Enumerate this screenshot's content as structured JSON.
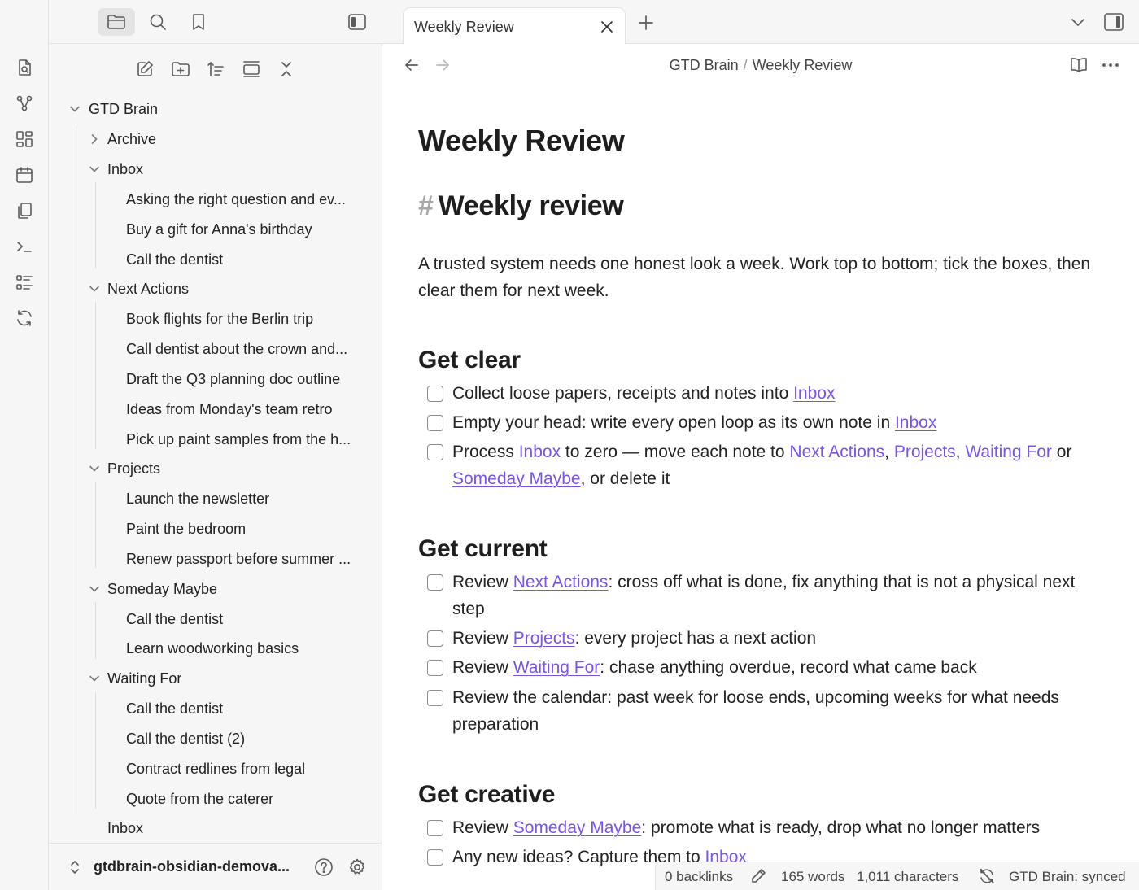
{
  "tab": {
    "title": "Weekly Review"
  },
  "breadcrumb": {
    "parent": "GTD Brain",
    "separator": "/",
    "current": "Weekly Review"
  },
  "tree": {
    "root": "GTD Brain",
    "archive": "Archive",
    "inbox_folder": "Inbox",
    "inbox_items": [
      "Asking the right question and ev...",
      "Buy a gift for Anna's birthday",
      "Call the dentist"
    ],
    "next_actions_folder": "Next Actions",
    "next_actions_items": [
      "Book flights for the Berlin trip",
      "Call dentist about the crown and...",
      "Draft the Q3 planning doc outline",
      "Ideas from Monday's team retro",
      "Pick up paint samples from the h..."
    ],
    "projects_folder": "Projects",
    "projects_items": [
      "Launch the newsletter",
      "Paint the bedroom",
      "Renew passport before summer ..."
    ],
    "someday_folder": "Someday Maybe",
    "someday_items": [
      "Call the dentist",
      "Learn woodworking basics"
    ],
    "waiting_folder": "Waiting For",
    "waiting_items": [
      "Call the dentist",
      "Call the dentist (2)",
      "Contract redlines from legal",
      "Quote from the caterer"
    ],
    "bottom_inbox": "Inbox"
  },
  "vault": {
    "name": "gtdbrain-obsidian-demova..."
  },
  "doc": {
    "title": "Weekly Review",
    "h1": "Weekly review",
    "hash": "#",
    "intro": "A trusted system needs one honest look a week. Work top to bottom; tick the boxes, then clear them for next week.",
    "sections": {
      "clear": {
        "heading": "Get clear",
        "t1": {
          "a": "Collect loose papers, receipts and notes into ",
          "link": "Inbox"
        },
        "t2": {
          "a": "Empty your head: write every open loop as its own note in ",
          "link": "Inbox"
        },
        "t3": {
          "a": "Process ",
          "l1": "Inbox",
          "b": " to zero — move each note to ",
          "l2": "Next Actions",
          "c": ", ",
          "l3": "Projects",
          "d": ", ",
          "l4": "Waiting For",
          "e": " or ",
          "l5": "Someday Maybe",
          "f": ", or delete it"
        }
      },
      "current": {
        "heading": "Get current",
        "t1": {
          "a": "Review ",
          "link": "Next Actions",
          "b": ": cross off what is done, fix anything that is not a physical next step"
        },
        "t2": {
          "a": "Review ",
          "link": "Projects",
          "b": ": every project has a next action"
        },
        "t3": {
          "a": "Review ",
          "link": "Waiting For",
          "b": ": chase anything overdue, record what came back"
        },
        "t4": {
          "text": "Review the calendar: past week for loose ends, upcoming weeks for what needs preparation"
        }
      },
      "creative": {
        "heading": "Get creative",
        "t1": {
          "a": "Review ",
          "link": "Someday Maybe",
          "b": ": promote what is ready, drop what no longer matters"
        },
        "t2": {
          "a": "Any new ideas? Capture them to ",
          "link": "Inbox"
        }
      }
    }
  },
  "status": {
    "backlinks": "0 backlinks",
    "words": "165 words",
    "characters": "1,011 characters",
    "sync": "GTD Brain: synced"
  },
  "colors": {
    "link": "#7852ee",
    "sidebar_bg": "#f6f6f6",
    "active_button": "#e4e4e4"
  }
}
